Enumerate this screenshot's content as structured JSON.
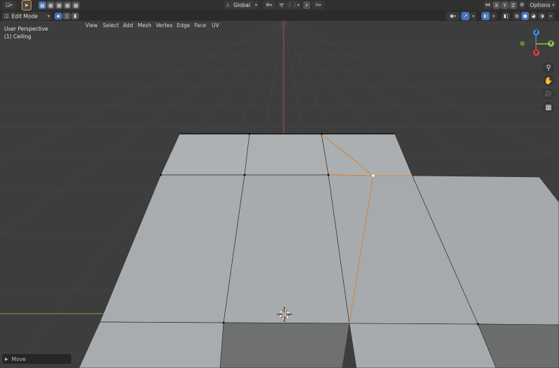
{
  "header": {
    "orientation": "Global",
    "axis_x": "X",
    "axis_y": "Y",
    "axis_z": "Z",
    "options": "Options"
  },
  "toolbar": {
    "mode": "Edit Mode",
    "menus": [
      "View",
      "Select",
      "Add",
      "Mesh",
      "Vertex",
      "Edge",
      "Face",
      "UV"
    ]
  },
  "viewport": {
    "perspective": "User Perspective",
    "object": "(1) Ceiling"
  },
  "gizmo": {
    "x": "X",
    "y": "Y",
    "z": "Z"
  },
  "operator_panel": {
    "label": "Move"
  },
  "colors": {
    "background": "#3d3d3d",
    "grid": "#474747",
    "face": "#a9acaf",
    "face_dark": "#6d706e",
    "selected_edge": "#e08a3c",
    "x_axis": "#e03f52",
    "y_axis": "#8bc34a",
    "z_axis": "#3d8ee0"
  }
}
